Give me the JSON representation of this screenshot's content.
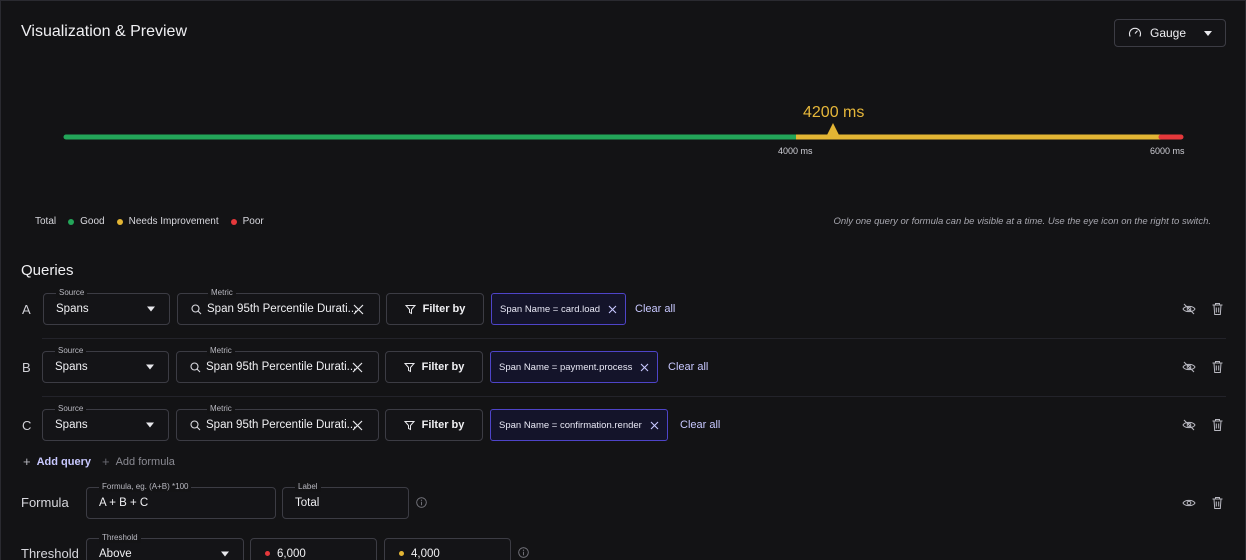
{
  "header": {
    "title": "Visualization & Preview",
    "viz_type": "Gauge"
  },
  "gauge": {
    "value_label": "4200 ms",
    "value": 4200,
    "threshold_ticks": [
      "4000 ms",
      "6000 ms"
    ],
    "colors": {
      "good": "#23a559",
      "needs_improvement": "#e3b534",
      "poor": "#e5383b"
    }
  },
  "legend": {
    "total": "Total",
    "items": [
      {
        "label": "Good",
        "color": "#23a559"
      },
      {
        "label": "Needs Improvement",
        "color": "#e3b534"
      },
      {
        "label": "Poor",
        "color": "#e5383b"
      }
    ]
  },
  "hint": "Only one query or formula can be visible at a time. Use the eye icon on the right to switch.",
  "queries": {
    "title": "Queries",
    "source_label": "Source",
    "metric_label": "Metric",
    "filter_by": "Filter by",
    "clear_all": "Clear all",
    "rows": [
      {
        "letter": "A",
        "source": "Spans",
        "metric": "Span 95th Percentile Durati...",
        "filter": "Span Name = card.load"
      },
      {
        "letter": "B",
        "source": "Spans",
        "metric": "Span 95th Percentile Durati...",
        "filter": "Span Name = payment.process"
      },
      {
        "letter": "C",
        "source": "Spans",
        "metric": "Span 95th Percentile Durati...",
        "filter": "Span Name = confirmation.render"
      }
    ],
    "add_query": "Add query",
    "add_formula": "Add formula"
  },
  "formula": {
    "title": "Formula",
    "field_label": "Formula, eg. (A+B) *100",
    "value": "A + B + C",
    "label_label": "Label",
    "label_value": "Total"
  },
  "threshold": {
    "title": "Threshold",
    "field_label": "Threshold",
    "mode": "Above",
    "poor_value": "6,000",
    "needs_value": "4,000"
  }
}
